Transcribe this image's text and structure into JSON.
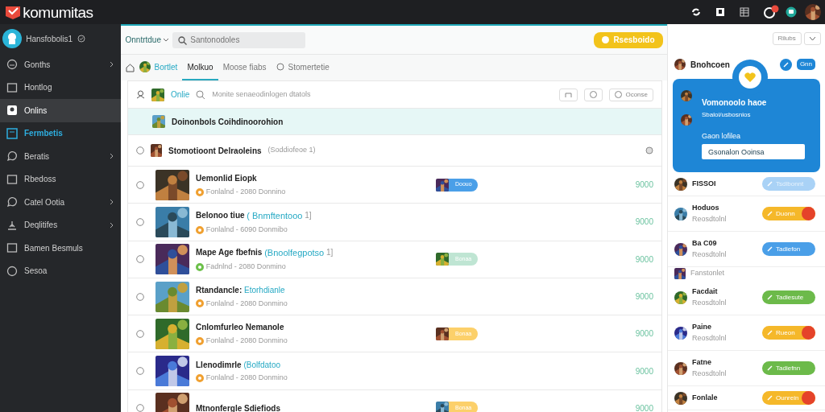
{
  "app": {
    "title": "komumitas",
    "notification": true
  },
  "sidebar": {
    "user": "Hansfobolis1",
    "items": [
      {
        "label": "Gonths",
        "submenu": true,
        "selected": false,
        "current": false
      },
      {
        "label": "Hontlog",
        "submenu": false,
        "selected": false,
        "current": false
      },
      {
        "label": "Onlins",
        "submenu": false,
        "selected": true,
        "current": false
      },
      {
        "label": "Fermbetis",
        "submenu": false,
        "selected": false,
        "current": true
      },
      {
        "label": "Beratis",
        "submenu": true,
        "selected": false,
        "current": false
      },
      {
        "label": "Rbedoss",
        "submenu": false,
        "selected": false,
        "current": false
      },
      {
        "label": "Catel Ootia",
        "submenu": true,
        "selected": false,
        "current": false
      },
      {
        "label": "Deqlitifes",
        "submenu": true,
        "selected": false,
        "current": false
      },
      {
        "label": "Bamen Besmuls",
        "submenu": false,
        "selected": false,
        "current": false
      },
      {
        "label": "Sesoa",
        "submenu": false,
        "selected": false,
        "current": false
      }
    ]
  },
  "toolbar": {
    "dropdown": "Onntrtdue",
    "search": {
      "placeholder": "Santonodoles"
    },
    "action": "Rsesboido"
  },
  "tabs": [
    {
      "label": "Bortlet",
      "kind": "avatar",
      "selected": false
    },
    {
      "label": "Molkuo",
      "kind": "plain",
      "selected": true
    },
    {
      "label": "Moose fiabs",
      "kind": "plain",
      "selected": false
    },
    {
      "label": "Stomertetie",
      "kind": "circle",
      "selected": false
    }
  ],
  "filter": {
    "label": "Onlie",
    "text": "Monite senaeodinlogen dtatols",
    "button": "Oconse"
  },
  "highlight": {
    "title": "Doinonbols Coihdinoorohion"
  },
  "group": {
    "title": "Stomotioont Delraoleins",
    "count": "(Soddiofeoe 1)",
    "selected": false
  },
  "rows": [
    {
      "title": "Uemonlid Eiopk",
      "sub": "Fonlalnd - 2080 Donnino",
      "color": "#f0a030",
      "badge": {
        "label": "Doouo",
        "color": "#4a9fe8"
      },
      "value": "9000",
      "selected": false
    },
    {
      "title": "Belonoo tiue",
      "tag": "( Bnmftentooo",
      "count": "1]",
      "sub": "Fonlalnd - 6090 Donmibo",
      "color": "#f0a030",
      "value": "9000",
      "selected": false
    },
    {
      "title": "Mape Age fbefnis",
      "tag": "(Bnoolfegpotso",
      "count": "1]",
      "sub": "Fadnlnd - 2080 Donmino",
      "color": "#6cc04a",
      "badge": {
        "label": "Bonaa",
        "color": "#bfe5d3"
      },
      "value": "9000",
      "selected": false
    },
    {
      "title": "Rtandancle:",
      "tag": "Etorhdianle",
      "sub": "Fonlalnd - 2080 Donmino",
      "color": "#f0a030",
      "value": "9000",
      "selected": false
    },
    {
      "title": "Cnlomfurleo Nemanole",
      "sub": "Fonlalnd - 2080 Donmino",
      "color": "#f0a030",
      "badge": {
        "label": "Bonaa",
        "color": "#fcd06a"
      },
      "value": "9000",
      "selected": false
    },
    {
      "title": "Llenodimrle",
      "tag": "(Bolfdatoo",
      "sub": "Fonlalnd - 2080 Donmino",
      "color": "#f0a030",
      "value": "9000",
      "selected": false
    },
    {
      "title": "Mtnonfergle Sdiefiods",
      "badge": {
        "label": "Bonaa",
        "color": "#fcd06a"
      },
      "value": "9000",
      "selected": false
    }
  ],
  "panel": {
    "button": "Rilubs",
    "profile": {
      "name": "Bnohcoen",
      "badge": "Gnn"
    },
    "card": {
      "title": "Vomonoolo haoe",
      "sub": "Sbaloi/usbosnios",
      "label": "Gaon lofilea",
      "value": "Gsonalon Ooinsa"
    },
    "people": [
      {
        "kind": "person",
        "name": "FISSOI",
        "button": "Tsdlbonnt",
        "color": "#a9d2f6",
        "disabled": true,
        "dismiss": false
      },
      {
        "kind": "person",
        "name": "Hoduos",
        "sub": "Reosdtolnl",
        "button": "Duonn",
        "color": "#f5b82a",
        "disabled": false,
        "dismiss": true
      },
      {
        "kind": "person",
        "name": "Ba C09",
        "sub": "Reosdtolnl",
        "button": "Tadiefon",
        "color": "#4a9fe8",
        "disabled": false,
        "dismiss": false
      },
      {
        "kind": "note",
        "name": "Fanstonlet"
      },
      {
        "kind": "person",
        "name": "Facdait",
        "sub": "Reosdtolnl",
        "button": "Tadiesute",
        "color": "#6cba4a",
        "disabled": false,
        "dismiss": false
      },
      {
        "kind": "person",
        "name": "Paine",
        "sub": "Reosdtolnl",
        "button": "Rueon",
        "color": "#f5b82a",
        "disabled": false,
        "dismiss": true
      },
      {
        "kind": "person",
        "name": "Fatne",
        "sub": "Reosdtolnl",
        "button": "Tadiefnn",
        "color": "#6cba4a",
        "disabled": false,
        "dismiss": false
      },
      {
        "kind": "person",
        "name": "Fonlale",
        "button": "Ounrein",
        "color": "#f5b82a",
        "disabled": false,
        "dismiss": true
      }
    ]
  }
}
